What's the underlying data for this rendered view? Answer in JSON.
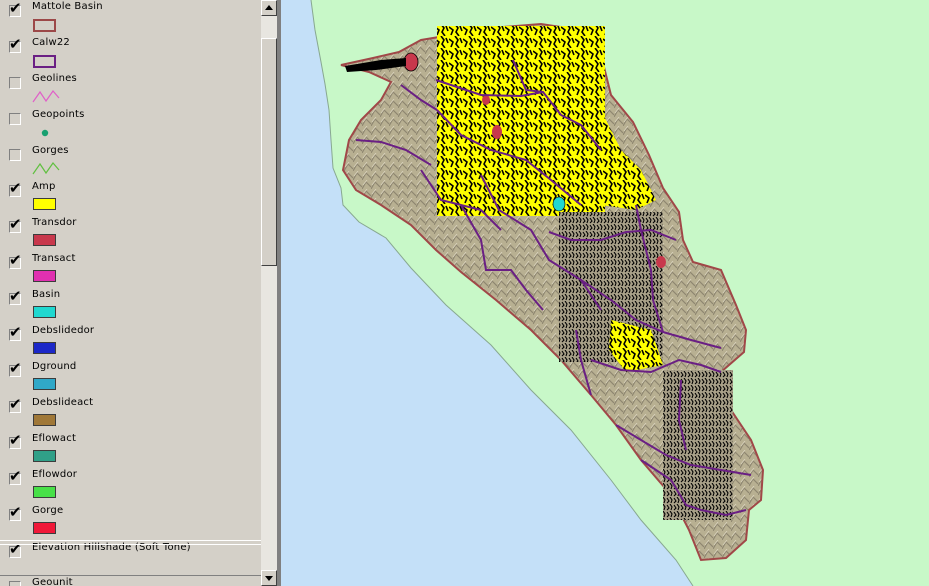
{
  "toc": {
    "layers": [
      {
        "name": "Mattole Basin",
        "checked": true,
        "symbol": "box",
        "color": "#9c4848"
      },
      {
        "name": "Calw22",
        "checked": true,
        "symbol": "box",
        "color": "#6a1f84"
      },
      {
        "name": "Geolines",
        "checked": false,
        "symbol": "line",
        "color": "#e060c8"
      },
      {
        "name": "Geopoints",
        "checked": false,
        "symbol": "point",
        "color": "#18a070"
      },
      {
        "name": "Gorges",
        "checked": false,
        "symbol": "line",
        "color": "#60c040"
      },
      {
        "name": "Amp",
        "checked": true,
        "symbol": "fill",
        "color": "#ffff00"
      },
      {
        "name": "Transdor",
        "checked": true,
        "symbol": "fill",
        "color": "#c8384c"
      },
      {
        "name": "Transact",
        "checked": true,
        "symbol": "fill",
        "color": "#e030b0"
      },
      {
        "name": "Basin",
        "checked": true,
        "symbol": "fill",
        "color": "#20d8d0"
      },
      {
        "name": "Debslidedor",
        "checked": true,
        "symbol": "fill",
        "color": "#1c28c8"
      },
      {
        "name": "Dground",
        "checked": true,
        "symbol": "fill",
        "color": "#30a8c8"
      },
      {
        "name": "Debslideact",
        "checked": true,
        "symbol": "fill",
        "color": "#a07838"
      },
      {
        "name": "Eflowact",
        "checked": true,
        "symbol": "fill",
        "color": "#30a088"
      },
      {
        "name": "Eflowdor",
        "checked": true,
        "symbol": "fill",
        "color": "#48e048"
      },
      {
        "name": "Gorge",
        "checked": true,
        "symbol": "fill",
        "color": "#f01838"
      },
      {
        "name": "Elevation Hillshade (Soft Tone)",
        "checked": true,
        "symbol": "none",
        "color": ""
      },
      {
        "name": "Geounit",
        "checked": false,
        "symbol": "none",
        "color": ""
      }
    ]
  },
  "map": {
    "land_color": "#c8f8c8",
    "ocean_color": "#c4e0f8",
    "basin_fill": "#b4ac90",
    "basin_outline": "#a04848",
    "subbasin_lines": "#6a1f84",
    "amp_color": "#ffff00",
    "slide_color": "#000000"
  }
}
